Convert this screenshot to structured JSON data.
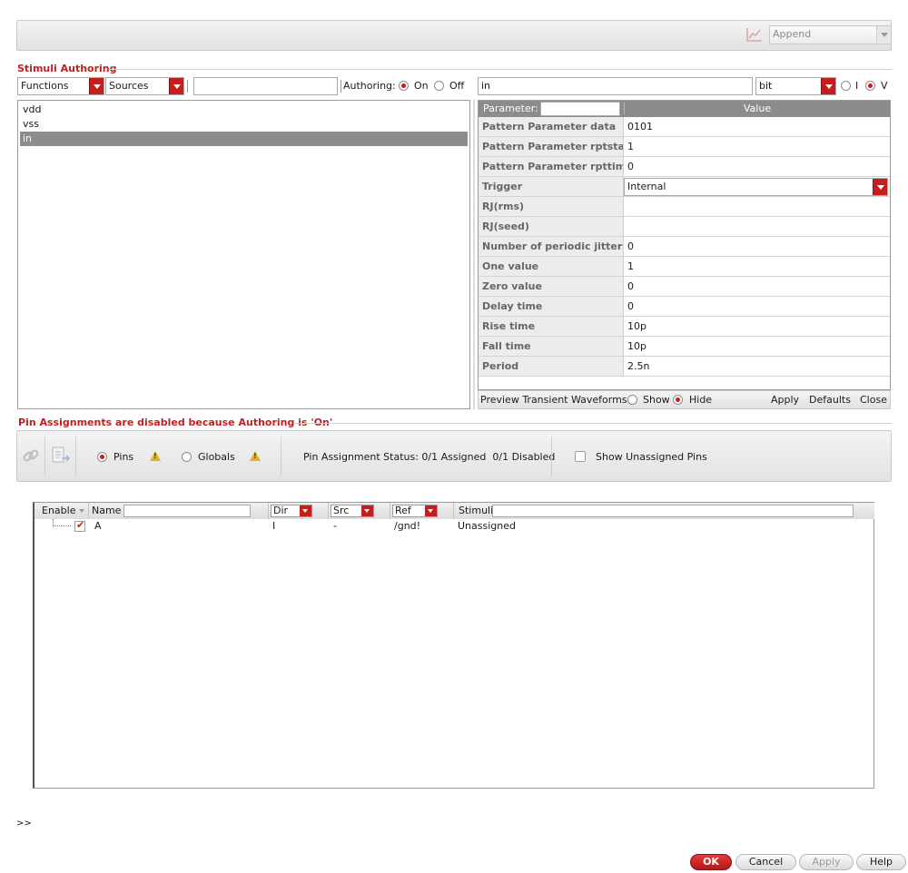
{
  "toolbar": {
    "mode_combo": "Append",
    "chart_icon": "line-chart-icon"
  },
  "stimuli": {
    "section_title": "Stimuli Authoring",
    "functions_combo": "Functions",
    "sources_combo": "Sources",
    "filter_value": "",
    "authoring_label": "Authoring:",
    "on_label": "On",
    "off_label": "Off",
    "signal_items": [
      "vdd",
      "vss",
      "in"
    ],
    "selected_signal": "in"
  },
  "props": {
    "name_value": "in",
    "type_combo": "bit",
    "i_label": "I",
    "v_label": "V",
    "param_header": "Parameter:",
    "param_filter": "",
    "value_header": "Value",
    "rows": [
      {
        "k": "Pattern Parameter data",
        "v": "0101"
      },
      {
        "k": "Pattern Parameter rptstart",
        "v": "1"
      },
      {
        "k": "Pattern Parameter rpttim...",
        "v": "0"
      },
      {
        "k": "Trigger",
        "v": "Internal"
      },
      {
        "k": "RJ(rms)",
        "v": ""
      },
      {
        "k": "RJ(seed)",
        "v": ""
      },
      {
        "k": "Number of periodic jitters",
        "v": "0"
      },
      {
        "k": "One value",
        "v": "1"
      },
      {
        "k": "Zero value",
        "v": "0"
      },
      {
        "k": "Delay time",
        "v": "0"
      },
      {
        "k": "Rise time",
        "v": "10p"
      },
      {
        "k": "Fall time",
        "v": "10p"
      },
      {
        "k": "Period",
        "v": "2.5n"
      }
    ],
    "preview_label": "Preview Transient Waveforms:",
    "show_label": "Show",
    "hide_label": "Hide",
    "apply_label": "Apply",
    "defaults_label": "Defaults",
    "close_label": "Close"
  },
  "pins": {
    "section_title": "Pin Assignments are disabled because Authoring is 'On'",
    "pins_label": "Pins",
    "globals_label": "Globals",
    "status_text": "Pin Assignment Status: 0/1 Assigned  0/1 Disabled",
    "show_unassigned_label": "Show Unassigned Pins"
  },
  "table": {
    "headers": {
      "enable": "Enable",
      "name": "Name",
      "dir": "Dir",
      "src": "Src",
      "ref": "Ref",
      "stimuli": "Stimuli"
    },
    "rows": [
      {
        "name": "A",
        "dir": "I",
        "src": "-",
        "ref": "/gnd!",
        "stimuli": "Unassigned"
      }
    ]
  },
  "console_prompt": ">>",
  "footer": {
    "ok_label": "OK",
    "cancel_label": "Cancel",
    "apply_label": "Apply",
    "help_label": "Help"
  }
}
